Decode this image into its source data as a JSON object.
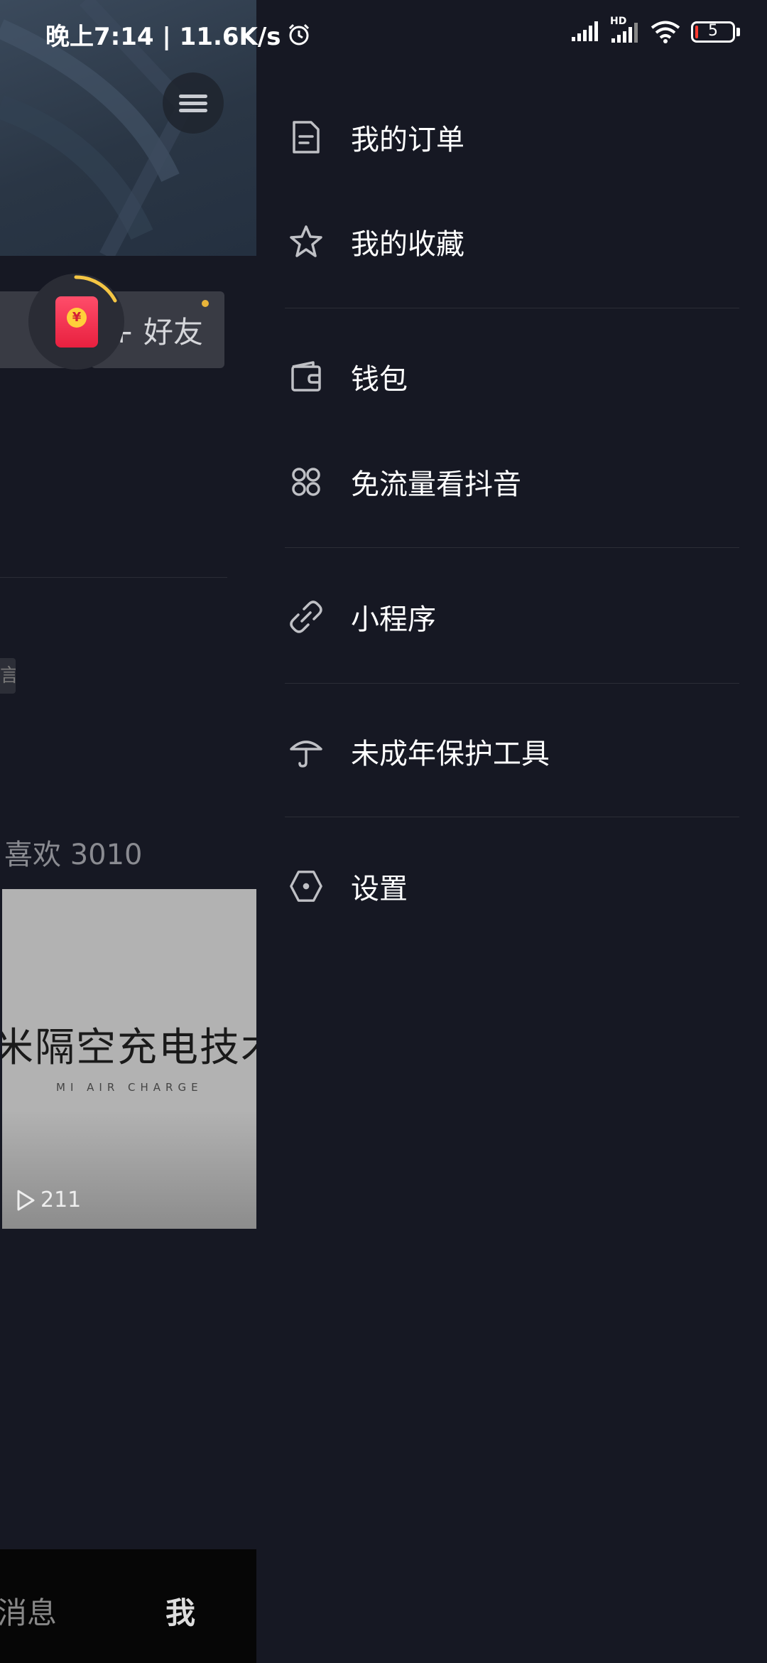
{
  "status_bar": {
    "time": "晚上7:14 | 11.6K/s",
    "battery": "5",
    "network_hd": "HD"
  },
  "left_page": {
    "add_friend": "+ 好友",
    "redpacket_symbol": "¥",
    "tag_stub": "言",
    "likes_tab": "喜欢 3010",
    "video": {
      "title": "米隔空充电技术",
      "subtitle": "MI AIR CHARGE",
      "plays": "211"
    },
    "bottom_nav": {
      "messages": "消息",
      "me": "我"
    }
  },
  "drawer": {
    "items": [
      {
        "label": "我的订单",
        "icon": "document-icon"
      },
      {
        "label": "我的收藏",
        "icon": "star-icon"
      },
      {
        "label": "钱包",
        "icon": "wallet-icon"
      },
      {
        "label": "免流量看抖音",
        "icon": "command-icon"
      },
      {
        "label": "小程序",
        "icon": "link-icon"
      },
      {
        "label": "未成年保护工具",
        "icon": "umbrella-icon"
      },
      {
        "label": "设置",
        "icon": "hexagon-settings-icon"
      }
    ]
  },
  "colors": {
    "background": "#161823",
    "divider": "#2b2d36",
    "icon": "#bfc0c5"
  }
}
